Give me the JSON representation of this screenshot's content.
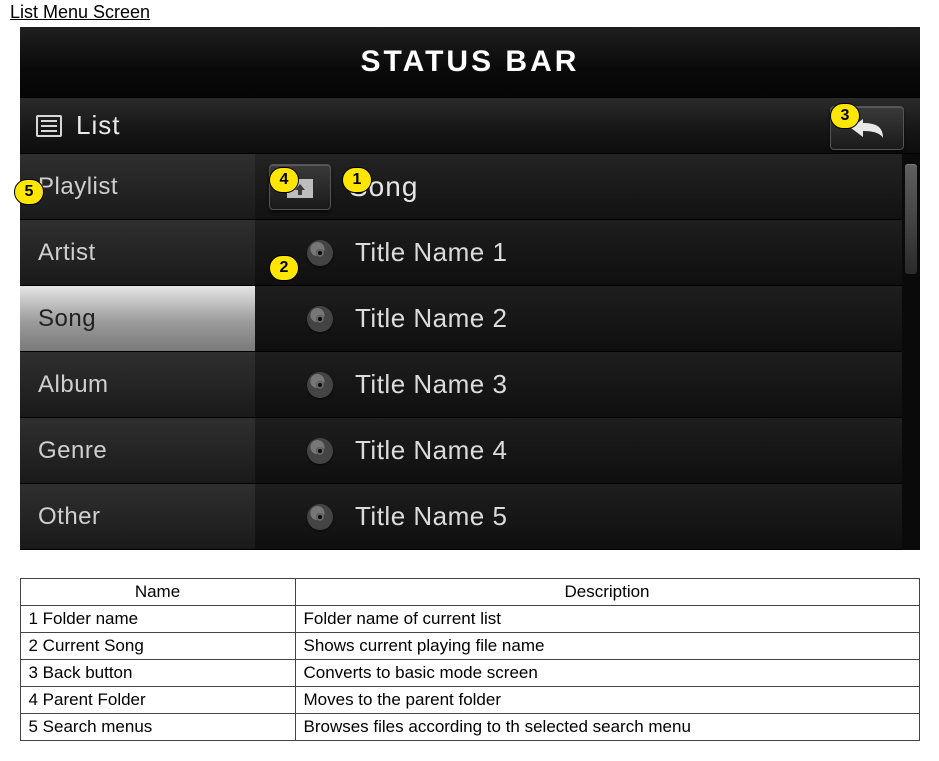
{
  "page_heading": "List Menu Screen",
  "device": {
    "status_bar": "STATUS BAR",
    "list_header": "List",
    "sidebar": {
      "items": [
        {
          "label": "Playlist"
        },
        {
          "label": "Artist"
        },
        {
          "label": "Song"
        },
        {
          "label": "Album"
        },
        {
          "label": "Genre"
        },
        {
          "label": "Other"
        }
      ],
      "selected_index": 2
    },
    "content": {
      "folder_name": "Song",
      "tracks": [
        {
          "title": "Title Name 1"
        },
        {
          "title": "Title Name 2"
        },
        {
          "title": "Title Name 3"
        },
        {
          "title": "Title Name 4"
        },
        {
          "title": "Title Name 5"
        }
      ]
    }
  },
  "callouts": {
    "c1": "1",
    "c2": "2",
    "c3": "3",
    "c4": "4",
    "c5": "5"
  },
  "table": {
    "headers": {
      "name": "Name",
      "desc": "Description"
    },
    "rows": [
      {
        "name": "1 Folder name",
        "desc": "Folder name of current list"
      },
      {
        "name": "2 Current Song",
        "desc": "Shows current playing file name"
      },
      {
        "name": "3 Back button",
        "desc": "Converts to basic mode screen"
      },
      {
        "name": "4 Parent Folder",
        "desc": "Moves to the parent folder"
      },
      {
        "name": "5 Search menus",
        "desc": "Browses files according to th selected search menu"
      }
    ]
  }
}
